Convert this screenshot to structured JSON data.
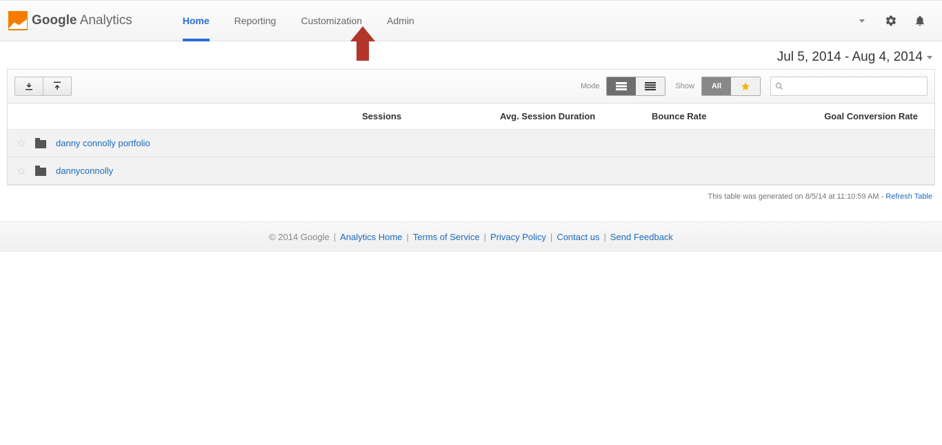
{
  "brand": {
    "strong": "Google",
    "light": "Analytics"
  },
  "nav": {
    "home": "Home",
    "reporting": "Reporting",
    "customization": "Customization",
    "admin": "Admin"
  },
  "date_range": "Jul 5, 2014 - Aug 4, 2014",
  "toolbar": {
    "mode_label": "Mode",
    "show_label": "Show",
    "all_label": "All",
    "search_placeholder": ""
  },
  "columns": {
    "sessions": "Sessions",
    "duration": "Avg. Session Duration",
    "bounce": "Bounce Rate",
    "goal": "Goal Conversion Rate"
  },
  "rows": [
    {
      "name": "danny connolly portfolio"
    },
    {
      "name": "dannyconnolly"
    }
  ],
  "gen_note": {
    "text": "This table was generated on 8/5/14 at 11:10:59 AM - ",
    "link": "Refresh Table"
  },
  "footer": {
    "copyright": "© 2014 Google",
    "links": {
      "analytics_home": "Analytics Home",
      "terms": "Terms of Service",
      "privacy": "Privacy Policy",
      "contact": "Contact us",
      "feedback": "Send Feedback"
    }
  },
  "annotation": {
    "target": "admin",
    "color": "#b3362b"
  }
}
